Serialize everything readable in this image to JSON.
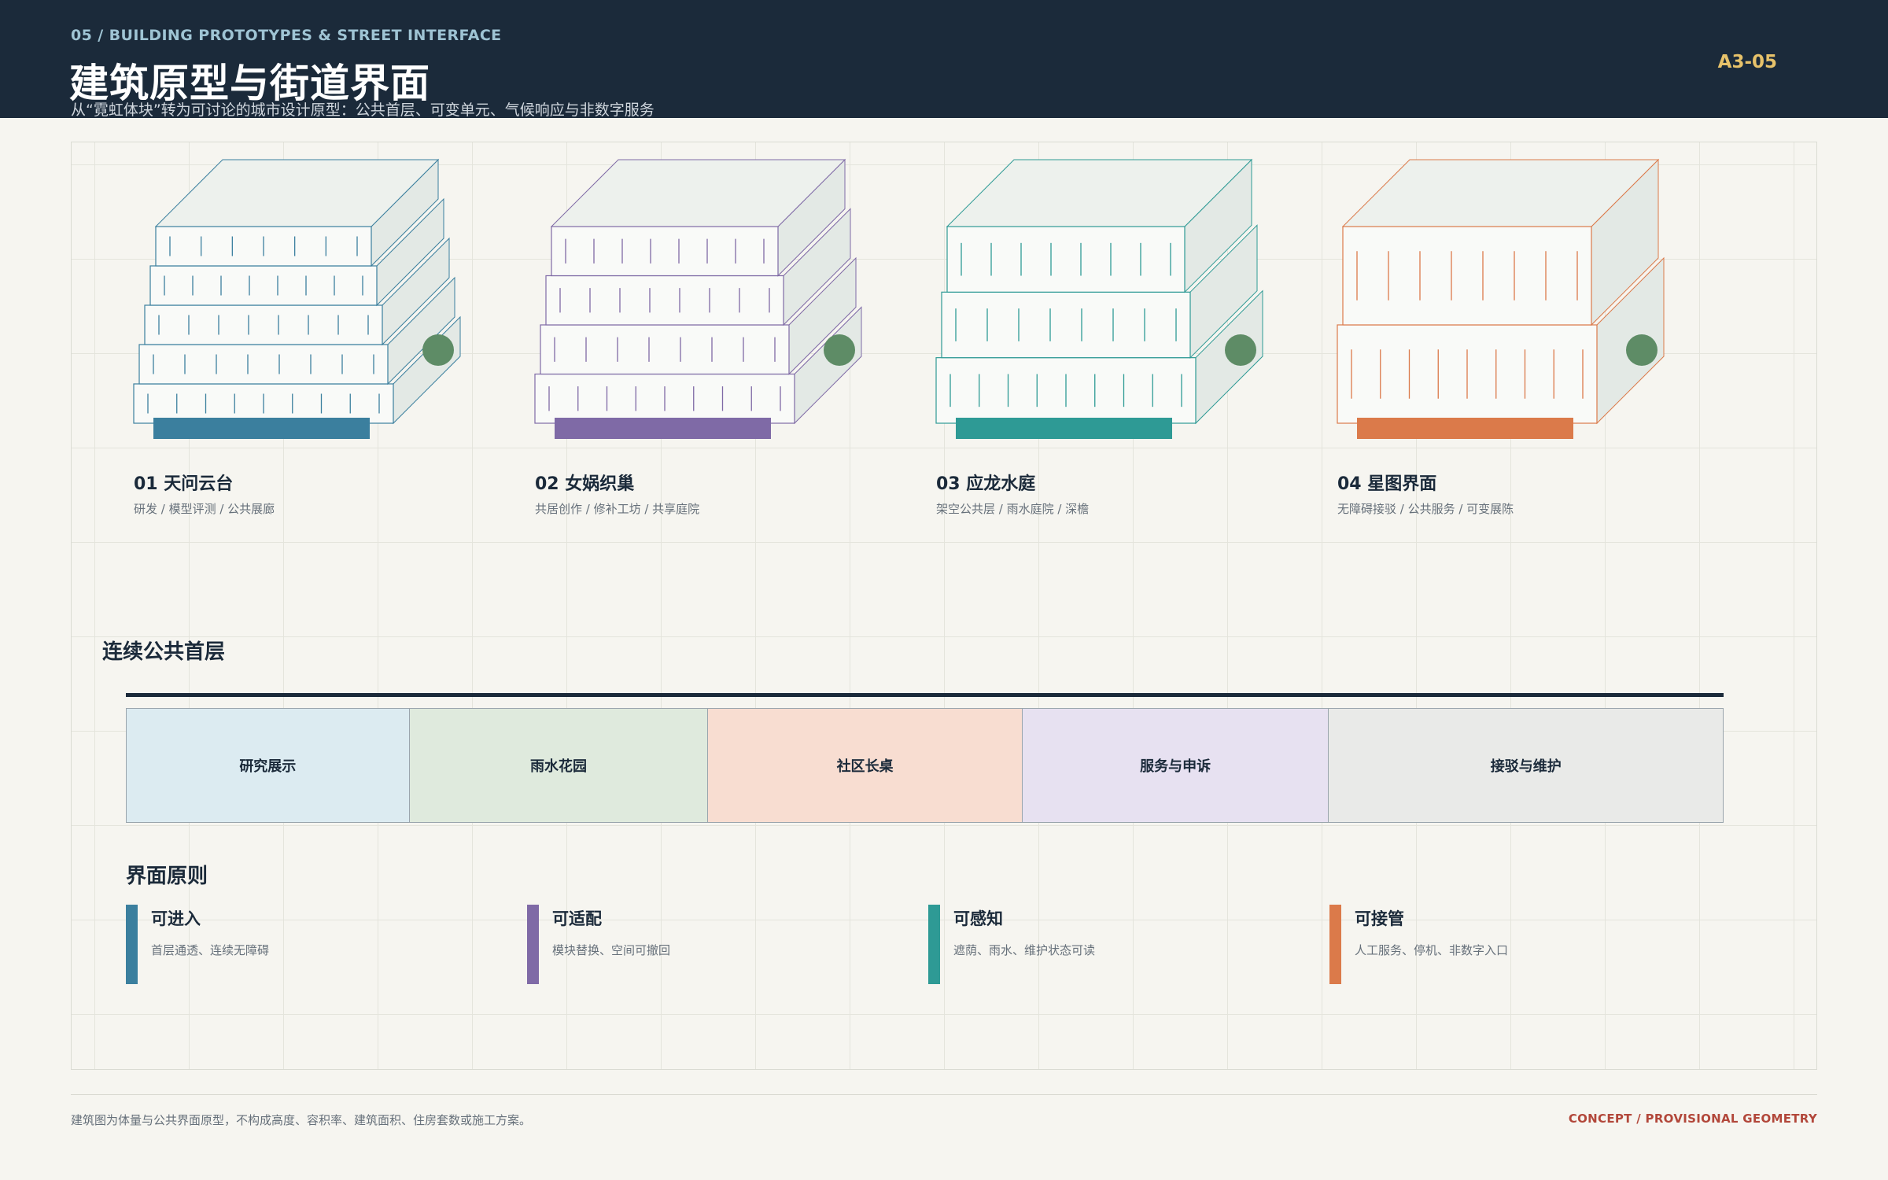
{
  "header": {
    "kicker": "05 / BUILDING PROTOTYPES & STREET INTERFACE",
    "title": "建筑原型与街道界面",
    "subtitle": "从“霓虹体块”转为可讨论的城市设计原型：公共首层、可变单元、气候响应与非数字服务",
    "sheet_number": "A3-05"
  },
  "prototypes": [
    {
      "title": "01  天问云台",
      "desc": "研发 / 模型评测 / 公共展廊",
      "floors": 5,
      "color": "#3b7f9e"
    },
    {
      "title": "02  女娲织巢",
      "desc": "共居创作 / 修补工坊 / 共享庭院",
      "floors": 4,
      "color": "#7f6aa6"
    },
    {
      "title": "03  应龙水庭",
      "desc": "架空公共层 / 雨水庭院 / 深檐",
      "floors": 3,
      "color": "#2e9a95"
    },
    {
      "title": "04  星图界面",
      "desc": "无障碍接驳 / 公共服务 / 可变展陈",
      "floors": 2,
      "color": "#db7a4a"
    }
  ],
  "ground_floor": {
    "title": "连续公共首层",
    "segments": [
      {
        "label": "研究展示",
        "color": "#dcebf1"
      },
      {
        "label": "雨水花园",
        "color": "#dfeadd"
      },
      {
        "label": "社区长桌",
        "color": "#f8ddd1"
      },
      {
        "label": "服务与申诉",
        "color": "#e7e1f1"
      },
      {
        "label": "接驳与维护",
        "color": "#e9eae8"
      }
    ]
  },
  "principles": {
    "title": "界面原则",
    "items": [
      {
        "title": "可进入",
        "desc": "首层通透、连续无障碍",
        "color": "#3b7f9e"
      },
      {
        "title": "可适配",
        "desc": "模块替换、空间可撤回",
        "color": "#7f6aa6"
      },
      {
        "title": "可感知",
        "desc": "遮荫、雨水、维护状态可读",
        "color": "#2e9a95"
      },
      {
        "title": "可接管",
        "desc": "人工服务、停机、非数字入口",
        "color": "#db7a4a"
      }
    ]
  },
  "colors": {
    "node": "#5e8c66",
    "face_top": "#edf1ed",
    "face_side": "#e3e9e5"
  },
  "footer": {
    "note": "建筑图为体量与公共界面原型，不构成高度、容积率、建筑面积、住房套数或施工方案。",
    "tag": "CONCEPT / PROVISIONAL GEOMETRY"
  }
}
